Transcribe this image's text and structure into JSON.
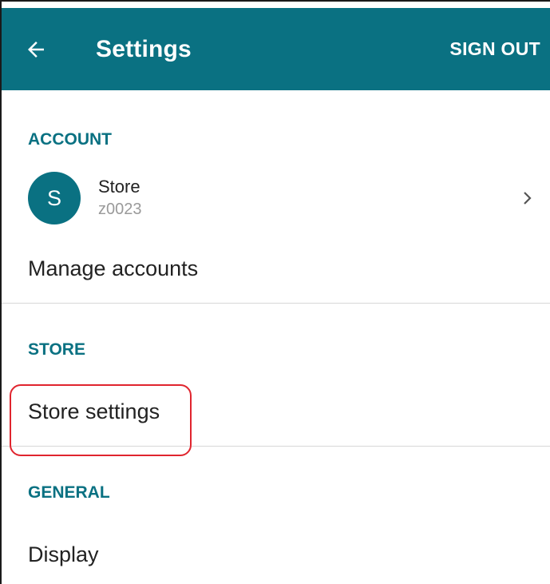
{
  "appbar": {
    "back_icon": "arrow-left-icon",
    "title": "Settings",
    "sign_out_label": "SIGN OUT",
    "color": "#0a7182"
  },
  "sections": {
    "account": {
      "header": "ACCOUNT",
      "account": {
        "avatar_letter": "S",
        "name": "Store",
        "id": "z0023",
        "chevron_icon": "chevron-right-icon"
      },
      "manage_label": "Manage accounts"
    },
    "store": {
      "header": "STORE",
      "settings_label": "Store settings"
    },
    "general": {
      "header": "GENERAL",
      "display_label": "Display"
    }
  },
  "annotation": {
    "highlight_color": "#e0252e"
  }
}
